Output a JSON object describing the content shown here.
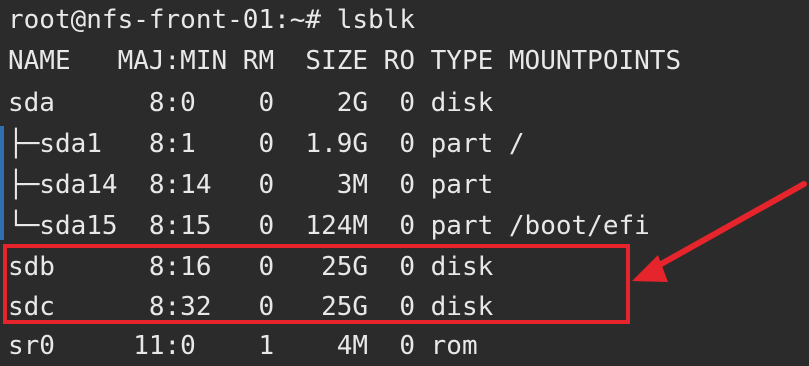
{
  "terminal": {
    "prompt_line": "root@nfs-front-01:~# lsblk",
    "header": "NAME   MAJ:MIN RM  SIZE RO TYPE MOUNTPOINTS",
    "rows": [
      "sda      8:0    0    2G  0 disk",
      "├─sda1   8:1    0  1.9G  0 part /",
      "├─sda14  8:14   0    3M  0 part",
      "└─sda15  8:15   0  124M  0 part /boot/efi",
      "sdb      8:16   0   25G  0 disk",
      "sdc      8:32   0   25G  0 disk",
      "sr0     11:0    1    4M  0 rom"
    ]
  },
  "annotation": {
    "highlight_color": "#e6242b",
    "arrow_color": "#e6242b",
    "highlighted_rows": [
      "sdb",
      "sdc"
    ]
  },
  "colors": {
    "background": "#2b2b2b",
    "text": "#e8e8e8",
    "gutter": "#2f6fb0"
  }
}
